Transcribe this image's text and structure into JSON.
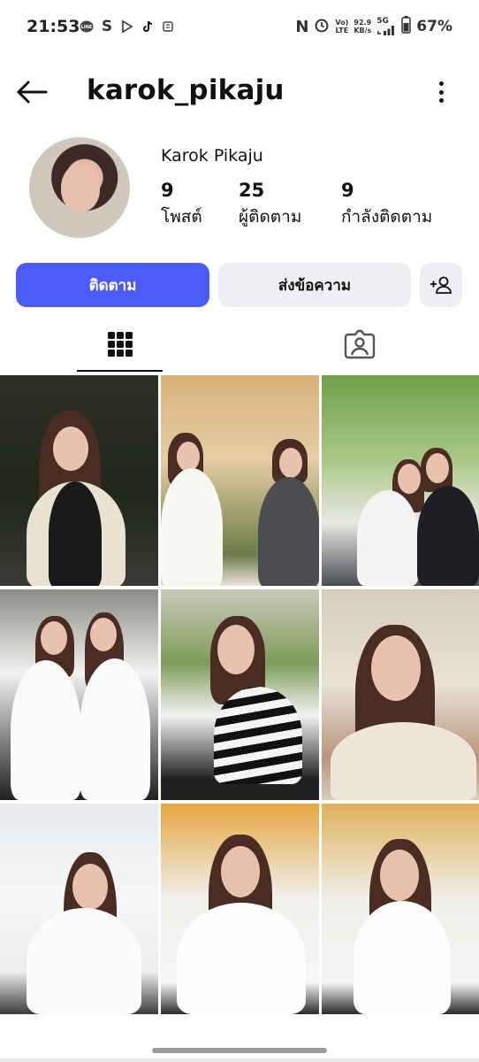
{
  "status_bar": {
    "time": "21:53",
    "network_type": "5G",
    "lte_label": "LTE",
    "volte_label": "Vo)",
    "speed_value": "92.9",
    "speed_unit": "KB/s",
    "battery": "67%"
  },
  "header": {
    "username": "karok_pikaju"
  },
  "profile": {
    "display_name": "Karok Pikaju",
    "posts": {
      "count": "9",
      "label": "โพสต์"
    },
    "followers": {
      "count": "25",
      "label": "ผู้ติดตาม"
    },
    "following": {
      "count": "9",
      "label": "กำลังติดตาม"
    }
  },
  "actions": {
    "follow_label": "ติดตาม",
    "message_label": "ส่งข้อความ"
  },
  "tabs": [
    {
      "icon": "grid-icon",
      "active": true
    },
    {
      "icon": "tagged-person-icon",
      "active": false
    }
  ],
  "colors": {
    "accent": "#4d5cf8",
    "secondary_button": "#efeff3"
  }
}
